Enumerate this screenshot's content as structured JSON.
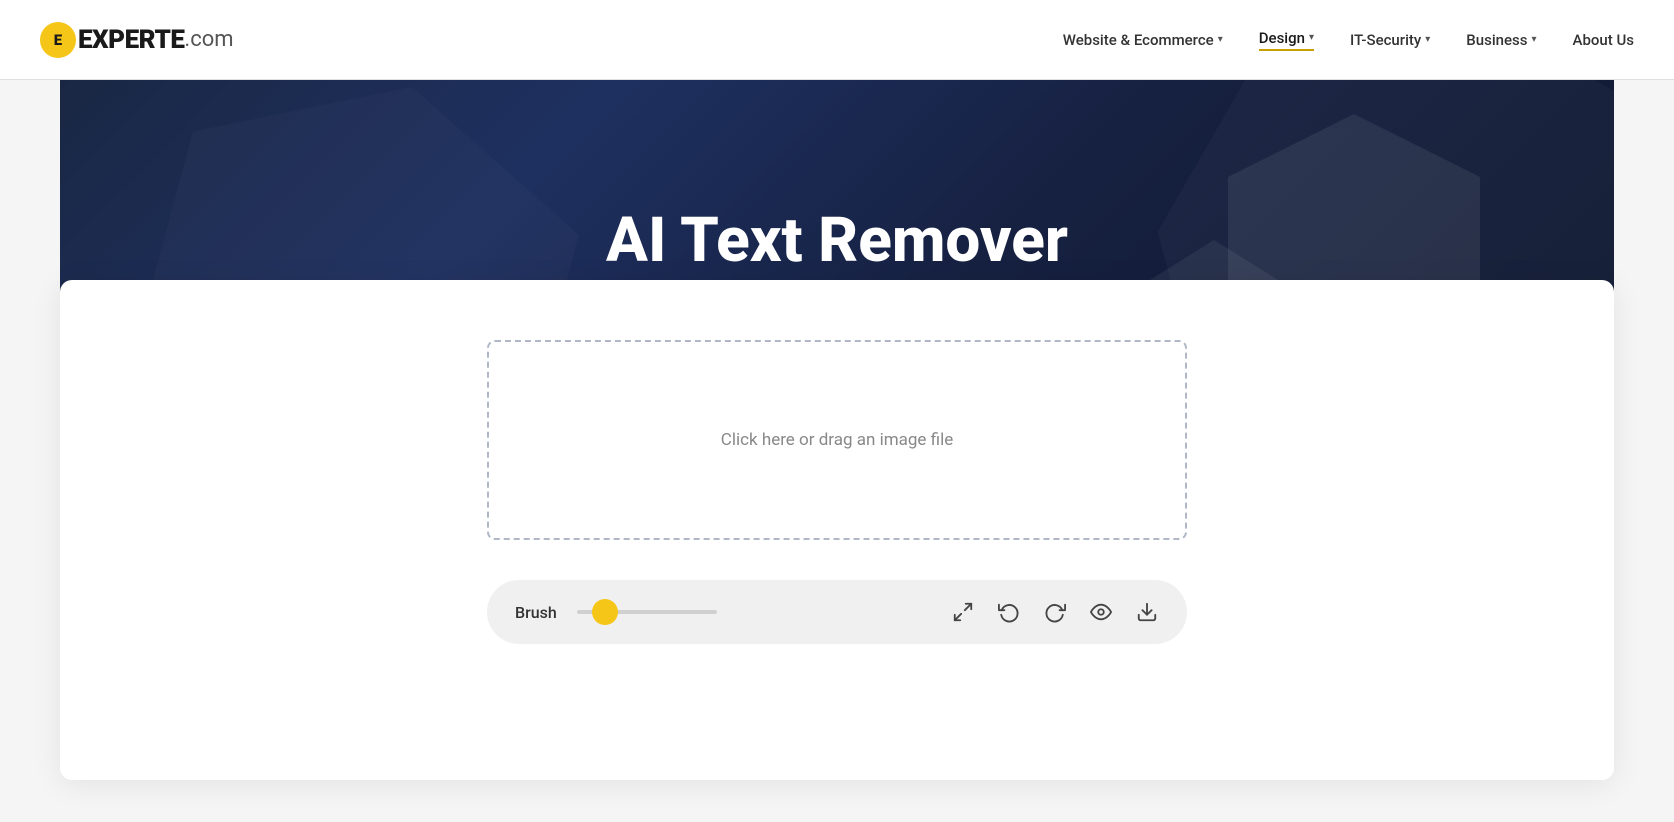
{
  "logo": {
    "icon_letter": "E",
    "text_experte": "EXPERTE",
    "text_com": ".com"
  },
  "nav": {
    "items": [
      {
        "label": "Website & Ecommerce",
        "has_dropdown": true,
        "active": false
      },
      {
        "label": "Design",
        "has_dropdown": true,
        "active": true
      },
      {
        "label": "IT-Security",
        "has_dropdown": true,
        "active": false
      },
      {
        "label": "Business",
        "has_dropdown": true,
        "active": false
      },
      {
        "label": "About Us",
        "has_dropdown": false,
        "active": false
      }
    ]
  },
  "hero": {
    "title": "AI Text Remover"
  },
  "tool": {
    "dropzone_label": "Click here or drag an image file",
    "brush_label": "Brush",
    "slider_value": 20
  },
  "toolbar_icons": [
    {
      "name": "expand-icon",
      "label": "Expand"
    },
    {
      "name": "undo-icon",
      "label": "Undo"
    },
    {
      "name": "redo-icon",
      "label": "Redo"
    },
    {
      "name": "preview-icon",
      "label": "Preview"
    },
    {
      "name": "download-icon",
      "label": "Download"
    }
  ],
  "colors": {
    "accent": "#f5c518",
    "nav_active_underline": "#c8a000",
    "hero_bg_start": "#1a2744",
    "hero_bg_end": "#0f1830"
  }
}
